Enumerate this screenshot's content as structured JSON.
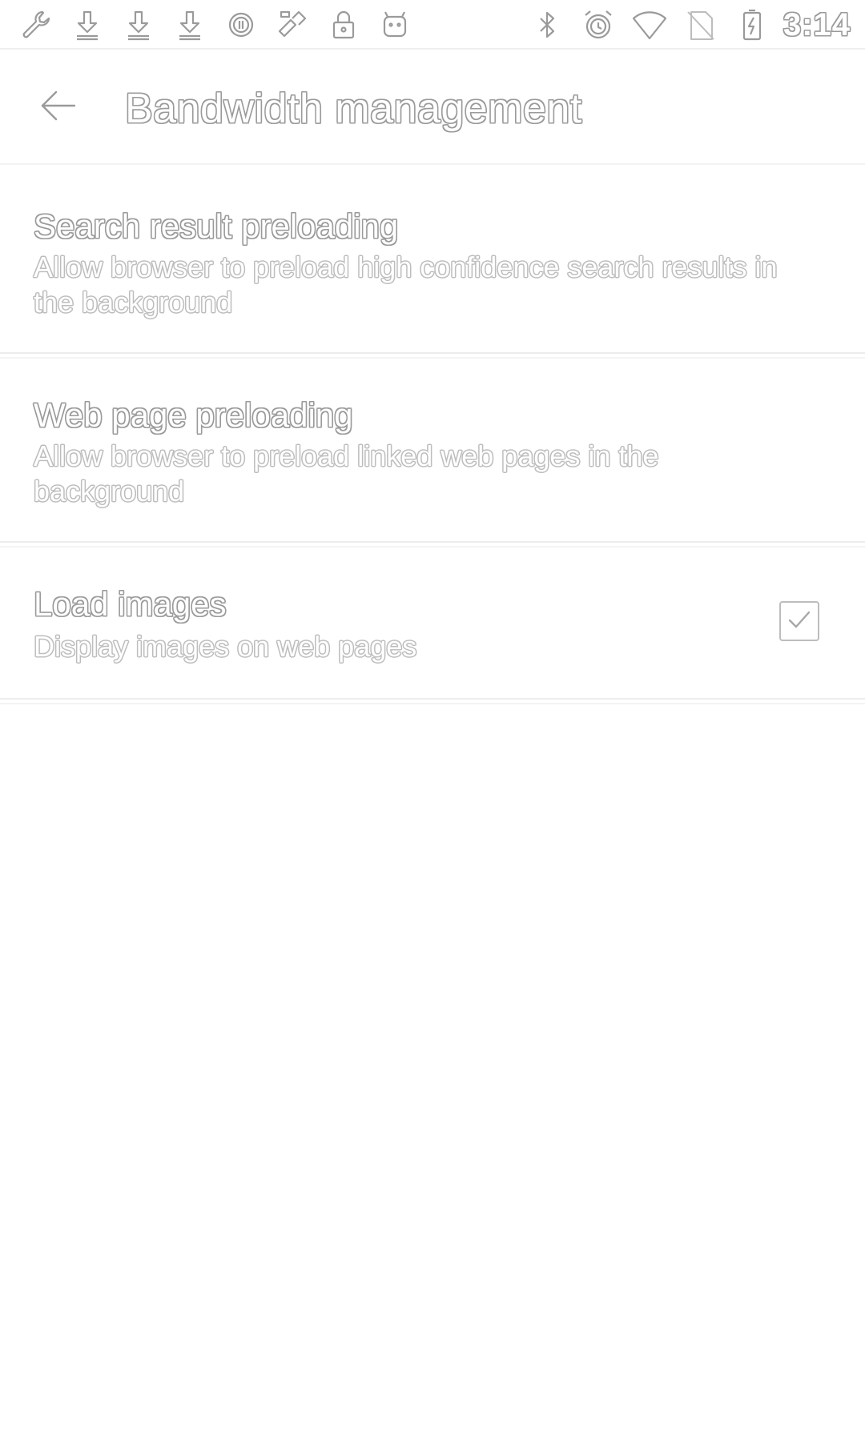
{
  "status_bar": {
    "left_icons": [
      "wrench-icon",
      "download-icon",
      "download-icon",
      "download-icon",
      "circle-badge-icon",
      "app-icon",
      "lock-icon",
      "android-icon"
    ],
    "right_icons": [
      "bluetooth-icon",
      "alarm-icon",
      "wifi-icon",
      "no-sim-icon",
      "battery-charging-icon"
    ],
    "time": "3:14"
  },
  "app_bar": {
    "back_icon": "arrow-back-icon",
    "title": "Bandwidth management"
  },
  "preferences": [
    {
      "title": "Search result preloading",
      "summary": "Allow browser to preload high confidence search results in the background"
    },
    {
      "title": "Web page preloading",
      "summary": "Allow browser to preload linked web pages in the background"
    },
    {
      "title": "Load images",
      "summary": "Display images on web pages",
      "checked": true
    }
  ],
  "colors": {
    "background": "#ffffff",
    "outline": "#9a9a9a",
    "divider": "#ececec"
  }
}
